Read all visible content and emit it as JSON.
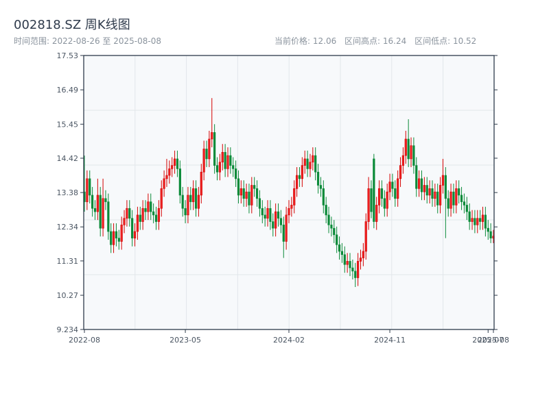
{
  "header": {
    "title": "002818.SZ 周K线图",
    "range_label": "时间范围: 2022-08-26 至 2025-08-08",
    "current_price": "当前价格: 12.06",
    "range_high": "区间高点: 16.24",
    "range_low": "区间低点: 10.52"
  },
  "chart_data": {
    "type": "candlestick",
    "title": "002818.SZ 周K线图",
    "period": "weekly",
    "start": "2022-08-26",
    "end": "2025-08-08",
    "ylim": [
      9.234,
      17.53
    ],
    "yticks": [
      "9.234",
      "10.27",
      "11.31",
      "12.34",
      "13.38",
      "14.42",
      "15.45",
      "16.49",
      "17.53"
    ],
    "xticks": [
      {
        "label": "2022-08",
        "index": 0
      },
      {
        "label": "2023-05",
        "index": 38
      },
      {
        "label": "2024-02",
        "index": 77
      },
      {
        "label": "2024-11",
        "index": 115
      },
      {
        "label": "2025-07",
        "index": 152
      },
      {
        "label": "2025-08",
        "index": 154
      }
    ],
    "colors": {
      "up": "#d40000",
      "down": "#0a8a38",
      "plot_bg": "#f7f9fb",
      "axis": "#2d3a4a",
      "grid": "#e2e6ea"
    },
    "grid": true,
    "ohlc_fields": [
      "open",
      "high",
      "low",
      "close"
    ],
    "candles": [
      [
        13.4,
        14.5,
        12.8,
        13.1
      ],
      [
        13.1,
        14.05,
        12.85,
        13.8
      ],
      [
        13.8,
        14.05,
        13.05,
        13.3
      ],
      [
        13.3,
        13.55,
        12.65,
        12.9
      ],
      [
        12.9,
        13.15,
        12.55,
        12.8
      ],
      [
        12.8,
        13.8,
        12.55,
        13.3
      ],
      [
        13.3,
        13.55,
        12.05,
        12.3
      ],
      [
        12.3,
        13.8,
        12.05,
        13.2
      ],
      [
        13.2,
        13.45,
        12.85,
        13.1
      ],
      [
        13.1,
        13.35,
        11.95,
        12.2
      ],
      [
        12.2,
        12.45,
        11.55,
        11.8
      ],
      [
        11.8,
        12.45,
        11.55,
        12.2
      ],
      [
        12.2,
        12.45,
        11.75,
        12.0
      ],
      [
        12.0,
        12.25,
        11.65,
        11.9
      ],
      [
        11.9,
        12.65,
        11.65,
        12.4
      ],
      [
        12.4,
        12.85,
        12.15,
        12.6
      ],
      [
        12.6,
        13.15,
        12.35,
        12.9
      ],
      [
        12.9,
        13.15,
        12.35,
        12.6
      ],
      [
        12.6,
        12.85,
        11.75,
        12.0
      ],
      [
        12.0,
        12.45,
        11.75,
        12.2
      ],
      [
        12.2,
        12.95,
        11.95,
        12.7
      ],
      [
        12.7,
        12.95,
        12.25,
        12.5
      ],
      [
        12.5,
        13.15,
        12.25,
        12.9
      ],
      [
        12.9,
        13.15,
        12.55,
        12.8
      ],
      [
        12.8,
        13.35,
        12.55,
        13.1
      ],
      [
        13.1,
        13.35,
        12.55,
        12.8
      ],
      [
        12.8,
        13.05,
        12.45,
        12.7
      ],
      [
        12.7,
        12.95,
        12.25,
        12.5
      ],
      [
        12.5,
        13.15,
        12.25,
        12.9
      ],
      [
        12.9,
        13.75,
        12.65,
        13.5
      ],
      [
        13.5,
        14.05,
        13.25,
        13.8
      ],
      [
        13.8,
        14.4,
        13.55,
        13.9
      ],
      [
        13.9,
        14.35,
        13.65,
        14.1
      ],
      [
        14.1,
        14.45,
        13.85,
        14.2
      ],
      [
        14.2,
        14.65,
        13.95,
        14.4
      ],
      [
        14.4,
        14.65,
        13.85,
        14.1
      ],
      [
        14.1,
        14.35,
        13.05,
        13.3
      ],
      [
        13.3,
        13.55,
        12.65,
        12.9
      ],
      [
        12.9,
        13.15,
        12.45,
        12.7
      ],
      [
        12.7,
        13.55,
        12.45,
        13.3
      ],
      [
        13.3,
        13.55,
        12.85,
        13.1
      ],
      [
        13.1,
        13.75,
        12.85,
        13.5
      ],
      [
        13.5,
        13.75,
        12.65,
        12.9
      ],
      [
        12.9,
        13.55,
        12.65,
        13.3
      ],
      [
        13.3,
        14.25,
        13.05,
        14.0
      ],
      [
        14.0,
        14.95,
        13.75,
        14.7
      ],
      [
        14.7,
        14.95,
        14.15,
        14.4
      ],
      [
        14.4,
        15.25,
        14.15,
        15.0
      ],
      [
        15.0,
        16.24,
        14.75,
        15.2
      ],
      [
        15.2,
        15.45,
        13.95,
        14.2
      ],
      [
        14.2,
        14.45,
        13.75,
        14.0
      ],
      [
        14.0,
        14.55,
        13.75,
        14.3
      ],
      [
        14.3,
        14.85,
        14.05,
        14.6
      ],
      [
        14.6,
        14.85,
        13.85,
        14.1
      ],
      [
        14.1,
        14.75,
        13.85,
        14.5
      ],
      [
        14.5,
        14.75,
        13.95,
        14.2
      ],
      [
        14.2,
        14.45,
        13.85,
        14.1
      ],
      [
        14.1,
        14.35,
        13.55,
        13.8
      ],
      [
        13.8,
        14.05,
        13.05,
        13.3
      ],
      [
        13.3,
        13.75,
        13.05,
        13.5
      ],
      [
        13.5,
        13.75,
        12.95,
        13.2
      ],
      [
        13.2,
        13.65,
        12.95,
        13.4
      ],
      [
        13.4,
        13.65,
        12.75,
        13.0
      ],
      [
        13.0,
        13.85,
        12.75,
        13.6
      ],
      [
        13.6,
        13.85,
        13.25,
        13.5
      ],
      [
        13.5,
        13.75,
        12.95,
        13.2
      ],
      [
        13.2,
        13.45,
        12.65,
        12.9
      ],
      [
        12.9,
        13.15,
        12.45,
        12.7
      ],
      [
        12.7,
        12.95,
        12.35,
        12.6
      ],
      [
        12.6,
        13.15,
        12.35,
        12.9
      ],
      [
        12.9,
        13.15,
        12.25,
        12.5
      ],
      [
        12.5,
        12.75,
        12.05,
        12.3
      ],
      [
        12.3,
        13.05,
        12.05,
        12.8
      ],
      [
        12.8,
        13.05,
        12.35,
        12.6
      ],
      [
        12.6,
        12.85,
        12.15,
        12.4
      ],
      [
        12.4,
        12.65,
        11.4,
        11.9
      ],
      [
        11.9,
        12.95,
        11.65,
        12.7
      ],
      [
        12.7,
        13.15,
        12.45,
        12.9
      ],
      [
        12.9,
        13.25,
        12.65,
        13.0
      ],
      [
        13.0,
        13.75,
        12.75,
        13.5
      ],
      [
        13.5,
        14.15,
        13.25,
        13.9
      ],
      [
        13.9,
        14.15,
        13.55,
        13.8
      ],
      [
        13.8,
        14.45,
        13.55,
        14.2
      ],
      [
        14.2,
        14.65,
        13.95,
        14.4
      ],
      [
        14.4,
        14.65,
        13.85,
        14.1
      ],
      [
        14.1,
        14.55,
        13.85,
        14.3
      ],
      [
        14.3,
        14.75,
        14.05,
        14.5
      ],
      [
        14.5,
        14.75,
        13.75,
        14.0
      ],
      [
        14.0,
        14.25,
        13.35,
        13.6
      ],
      [
        13.6,
        13.85,
        13.25,
        13.5
      ],
      [
        13.5,
        13.75,
        12.75,
        13.0
      ],
      [
        13.0,
        13.25,
        12.45,
        12.7
      ],
      [
        12.7,
        12.95,
        12.15,
        12.4
      ],
      [
        12.4,
        12.65,
        12.05,
        12.3
      ],
      [
        12.3,
        12.55,
        11.85,
        12.1
      ],
      [
        12.1,
        12.35,
        11.55,
        11.8
      ],
      [
        11.8,
        12.05,
        11.35,
        11.6
      ],
      [
        11.6,
        11.85,
        11.25,
        11.5
      ],
      [
        11.5,
        11.75,
        10.95,
        11.2
      ],
      [
        11.2,
        11.55,
        10.95,
        11.3
      ],
      [
        11.3,
        11.55,
        10.85,
        11.1
      ],
      [
        11.1,
        11.35,
        10.75,
        11.0
      ],
      [
        11.0,
        11.25,
        10.52,
        10.8
      ],
      [
        10.8,
        11.55,
        10.55,
        11.3
      ],
      [
        11.3,
        11.65,
        11.05,
        11.4
      ],
      [
        11.4,
        11.85,
        11.15,
        11.6
      ],
      [
        11.6,
        12.75,
        11.35,
        12.5
      ],
      [
        12.5,
        13.85,
        12.25,
        13.5
      ],
      [
        13.5,
        13.75,
        12.6,
        12.8
      ],
      [
        14.4,
        14.55,
        12.3,
        12.5
      ],
      [
        12.5,
        13.25,
        12.25,
        13.0
      ],
      [
        13.0,
        13.75,
        12.75,
        13.5
      ],
      [
        13.5,
        13.75,
        12.95,
        13.2
      ],
      [
        13.2,
        13.45,
        12.65,
        12.9
      ],
      [
        12.9,
        13.65,
        12.65,
        13.4
      ],
      [
        13.4,
        13.95,
        13.15,
        13.7
      ],
      [
        13.7,
        13.95,
        13.25,
        13.5
      ],
      [
        13.5,
        13.75,
        12.95,
        13.2
      ],
      [
        13.2,
        14.05,
        12.95,
        13.8
      ],
      [
        13.8,
        14.45,
        13.55,
        14.2
      ],
      [
        14.2,
        14.75,
        13.95,
        14.5
      ],
      [
        14.5,
        15.25,
        14.25,
        15.0
      ],
      [
        15.0,
        15.6,
        14.15,
        14.4
      ],
      [
        14.4,
        15.05,
        14.15,
        14.8
      ],
      [
        14.8,
        15.05,
        13.95,
        14.2
      ],
      [
        14.2,
        14.45,
        13.25,
        13.5
      ],
      [
        13.5,
        14.05,
        13.25,
        13.8
      ],
      [
        13.8,
        14.05,
        13.15,
        13.4
      ],
      [
        13.4,
        13.85,
        13.15,
        13.6
      ],
      [
        13.6,
        13.85,
        13.05,
        13.3
      ],
      [
        13.3,
        13.75,
        13.05,
        13.5
      ],
      [
        13.5,
        13.75,
        12.95,
        13.2
      ],
      [
        13.2,
        13.65,
        12.95,
        13.4
      ],
      [
        13.4,
        13.65,
        12.75,
        13.0
      ],
      [
        13.0,
        13.85,
        12.75,
        13.6
      ],
      [
        13.6,
        14.4,
        13.35,
        13.9
      ],
      [
        13.9,
        14.15,
        12.0,
        13.2
      ],
      [
        13.2,
        13.45,
        12.65,
        12.9
      ],
      [
        12.9,
        13.65,
        12.65,
        13.4
      ],
      [
        13.4,
        13.65,
        12.75,
        13.0
      ],
      [
        13.0,
        13.75,
        12.75,
        13.5
      ],
      [
        13.5,
        13.75,
        13.05,
        13.3
      ],
      [
        13.3,
        13.55,
        12.85,
        13.1
      ],
      [
        13.1,
        13.35,
        12.75,
        13.0
      ],
      [
        13.0,
        13.25,
        12.55,
        12.8
      ],
      [
        12.8,
        13.05,
        12.25,
        12.5
      ],
      [
        12.5,
        12.85,
        12.25,
        12.6
      ],
      [
        12.6,
        12.85,
        12.15,
        12.4
      ],
      [
        12.4,
        12.85,
        12.15,
        12.6
      ],
      [
        12.6,
        12.85,
        12.25,
        12.5
      ],
      [
        12.5,
        12.95,
        12.25,
        12.7
      ],
      [
        12.7,
        12.95,
        12.05,
        12.3
      ],
      [
        12.3,
        12.55,
        11.95,
        12.2
      ],
      [
        12.2,
        12.45,
        11.85,
        12.0
      ],
      [
        12.0,
        12.25,
        11.85,
        12.06
      ]
    ]
  }
}
